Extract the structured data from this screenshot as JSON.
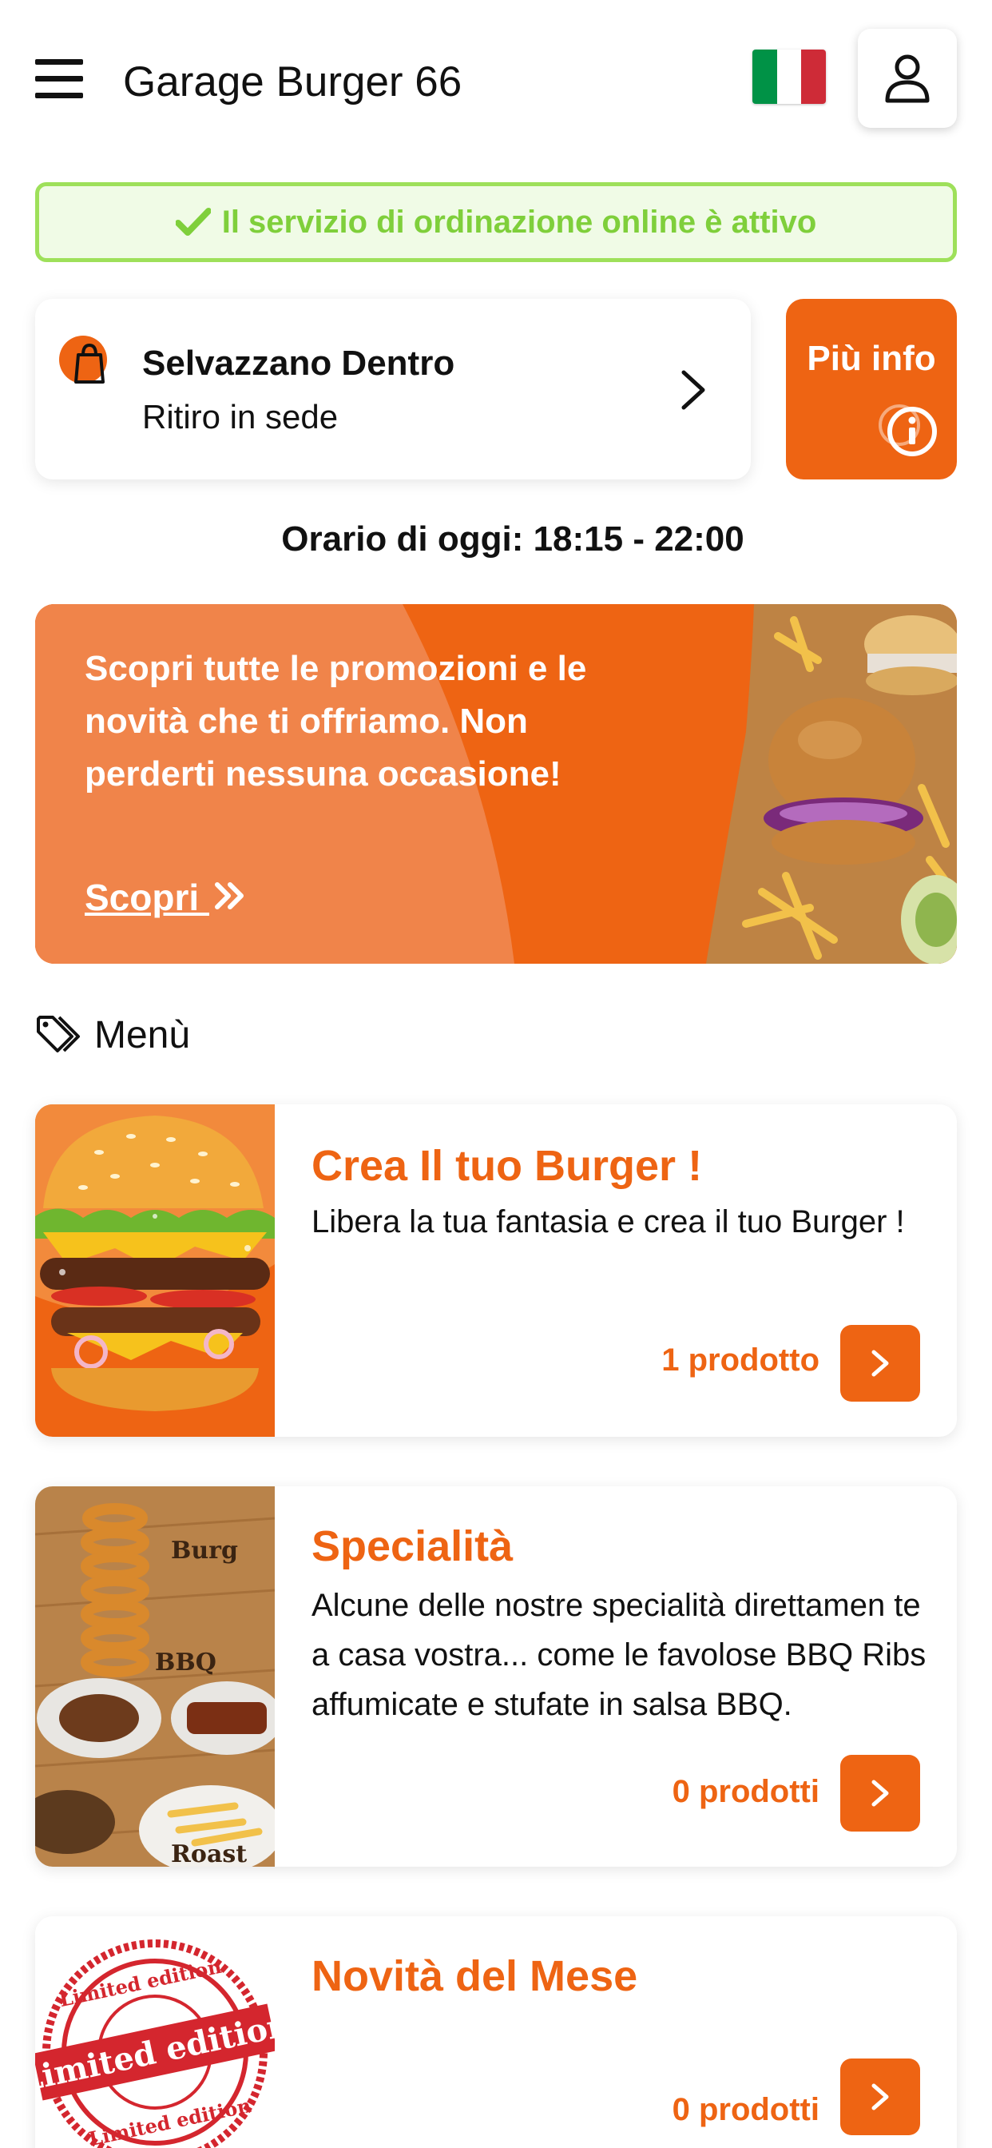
{
  "header": {
    "title": "Garage Burger 66",
    "menu_icon": "hamburger-menu-icon",
    "language_flag": "italy-flag-icon",
    "account_icon": "user-icon"
  },
  "status": {
    "text": "Il servizio di ordinazione online è attivo",
    "icon": "check-icon"
  },
  "location": {
    "name": "Selvazzano Dentro",
    "mode": "Ritiro in sede",
    "icon": "shopping-bag-icon"
  },
  "info_button": {
    "label": "Più info",
    "icon": "info-icon"
  },
  "hours": {
    "text": "Orario di oggi: 18:15 - 22:00"
  },
  "promo": {
    "text": "Scopri tutte le promozioni e le novità che ti offriamo. Non perderti nessuna occasione!",
    "link_label": "Scopri ",
    "link_icon": "double-chevron-right-icon"
  },
  "menu": {
    "heading": "Menù",
    "heading_icon": "tag-icon",
    "categories": [
      {
        "title": "Crea Il tuo Burger !",
        "description": "Libera la tua fantasia e crea il tuo Burger !",
        "count": "1 prodotto"
      },
      {
        "title": "Specialità",
        "description": "Alcune delle nostre specialità direttamen te a casa vostra... come le favolose BBQ Ribs affumicate e stufate in salsa BBQ.",
        "count": "0 prodotti"
      },
      {
        "title": "Novità del Mese",
        "description": "",
        "count": "0 prodotti",
        "stamp_text": "Limited edition"
      }
    ]
  },
  "colors": {
    "accent": "#ee6413",
    "status_green": "#7fcf3b",
    "status_border": "#9ee05a",
    "flag_green": "#009246",
    "flag_white": "#ffffff",
    "flag_red": "#ce2b37"
  }
}
